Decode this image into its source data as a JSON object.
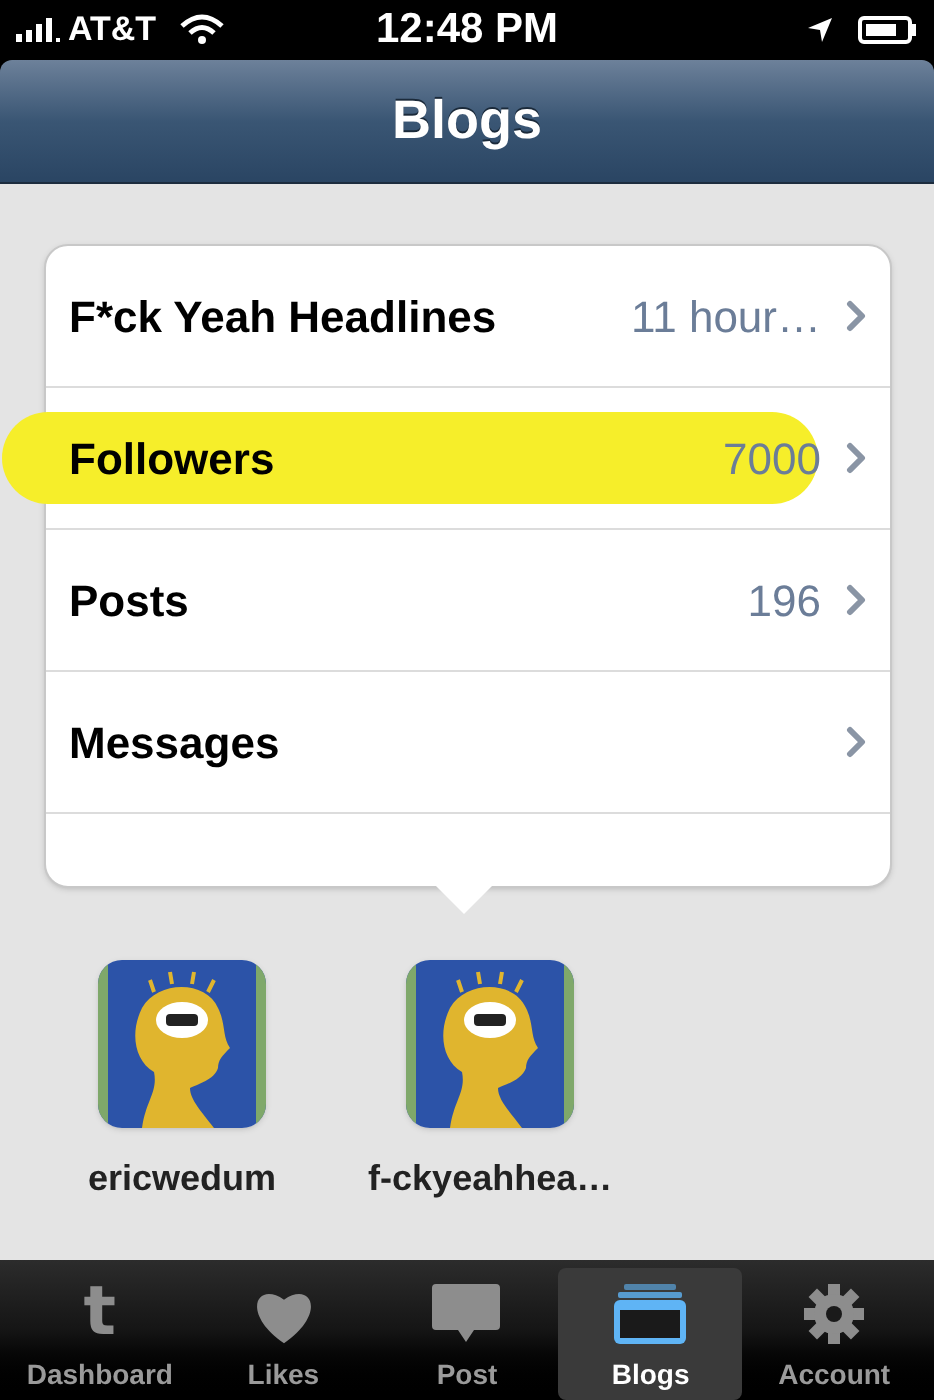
{
  "status_bar": {
    "carrier": "AT&T",
    "time": "12:48 PM"
  },
  "nav_bar": {
    "title": "Blogs"
  },
  "menu": [
    {
      "label": "F*ck Yeah Headlines",
      "value": "11 hour…",
      "highlighted": false
    },
    {
      "label": "Followers",
      "value": "7000",
      "highlighted": true
    },
    {
      "label": "Posts",
      "value": "196",
      "highlighted": false
    },
    {
      "label": "Messages",
      "highlighted": false
    }
  ],
  "blogs": [
    {
      "name": "ericwedum",
      "kind": "picture"
    },
    {
      "name": "f-ckyeahhea…",
      "kind": "picture"
    }
  ],
  "tab_bar": [
    {
      "label": "Dashboard",
      "kind": "tumblr",
      "icon_text": "t",
      "selected": false
    },
    {
      "label": "Likes",
      "kind": "heart",
      "selected": false
    },
    {
      "label": "Post",
      "kind": "bubble",
      "selected": false
    },
    {
      "label": "Blogs",
      "kind": "stack",
      "selected": true
    },
    {
      "label": "Account",
      "kind": "gear",
      "selected": false
    }
  ]
}
